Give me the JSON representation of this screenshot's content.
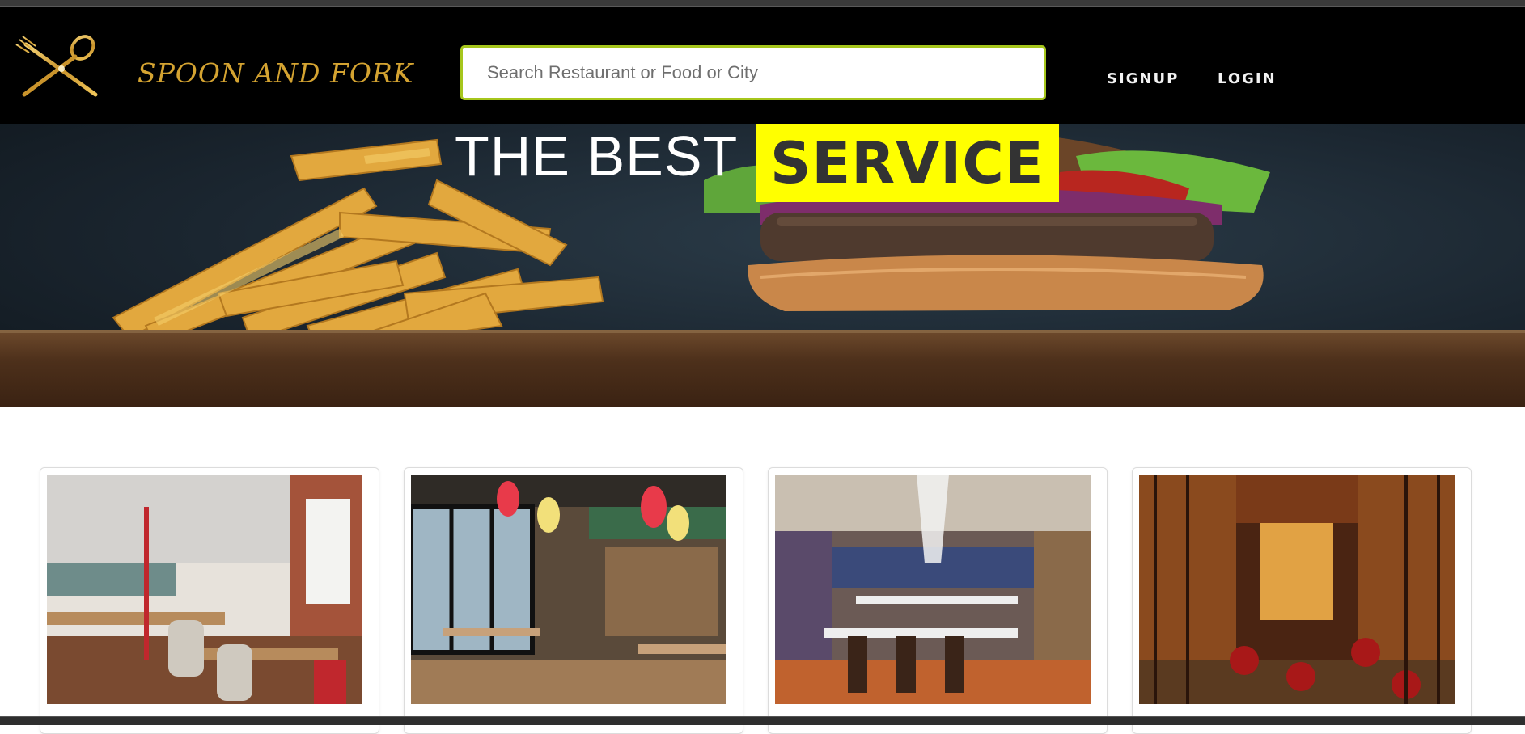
{
  "brand": {
    "name": "SPOON AND FORK",
    "color": "#d4a331",
    "logo_icon": "crossed-spoon-fork-icon"
  },
  "search": {
    "placeholder": "Search Restaurant or Food or City",
    "value": "",
    "border_color": "#a6c61c"
  },
  "nav": {
    "signup_label": "SIGNUP",
    "login_label": "LOGIN"
  },
  "hero": {
    "title": "THE BEST",
    "badge_text": "SERVICE",
    "badge_color": "#ffff00",
    "image": "fries-and-burger-photo"
  },
  "cards": [
    {
      "label": "",
      "image": "restaurant-interior-photo-1"
    },
    {
      "label": "",
      "image": "restaurant-interior-photo-2"
    },
    {
      "label": "",
      "image": "restaurant-interior-photo-3"
    },
    {
      "label": "",
      "image": "restaurant-interior-photo-4"
    }
  ]
}
